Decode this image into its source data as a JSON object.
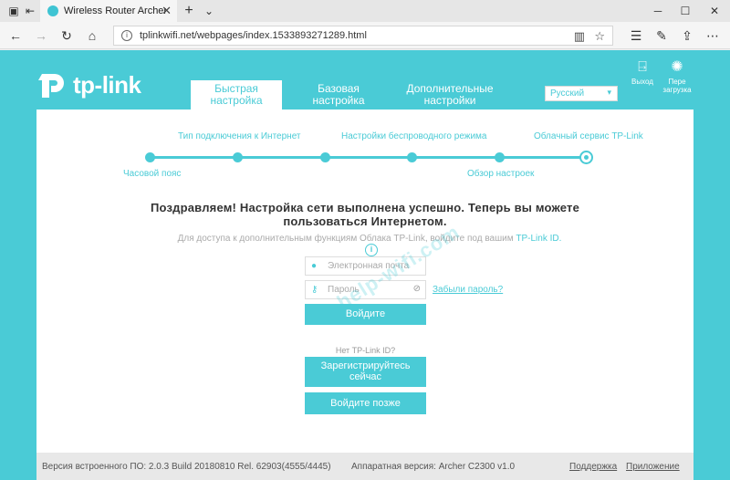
{
  "browser": {
    "tab_title": "Wireless Router Archer",
    "url": "tplinkwifi.net/webpages/index.1533893271289.html"
  },
  "header": {
    "logo_text": "tp-link",
    "tabs": [
      {
        "label": "Быстрая настройка",
        "active": true
      },
      {
        "label": "Базовая настройка",
        "active": false
      },
      {
        "label": "Дополнительные настройки",
        "active": false
      }
    ],
    "language": "Русский",
    "logout_label": "Выход",
    "reboot_label": "Пере загрузка"
  },
  "steps": {
    "top_labels": [
      "Тип подключения к Интернет",
      "Настройки беспроводного режима",
      "Облачный сервис TP-Link"
    ],
    "bottom_labels": [
      "Часовой пояс",
      "Обзор настроек"
    ]
  },
  "main": {
    "congrats": "Поздравляем! Настройка сети выполнена успешно. Теперь вы можете пользоваться Интернетом.",
    "subtext": "Для доступа к дополнительным функциям Облака TP-Link, войдите под вашим",
    "subtext_link": "TP-Link ID.",
    "email_placeholder": "Электронная почта",
    "password_placeholder": "Пароль",
    "forgot_label": "Забыли пароль?",
    "login_button": "Войдите",
    "no_id_text": "Нет TP-Link ID?",
    "register_button": "Зарегистрируйтесь сейчас",
    "later_button": "Войдите позже"
  },
  "footer": {
    "firmware": "Версия встроенного ПО: 2.0.3 Build 20180810 Rel. 62903(4555/4445)",
    "hardware": "Аппаратная версия: Archer C2300 v1.0",
    "support": "Поддержка",
    "app": "Приложение"
  },
  "watermark": "help-wifi.com"
}
